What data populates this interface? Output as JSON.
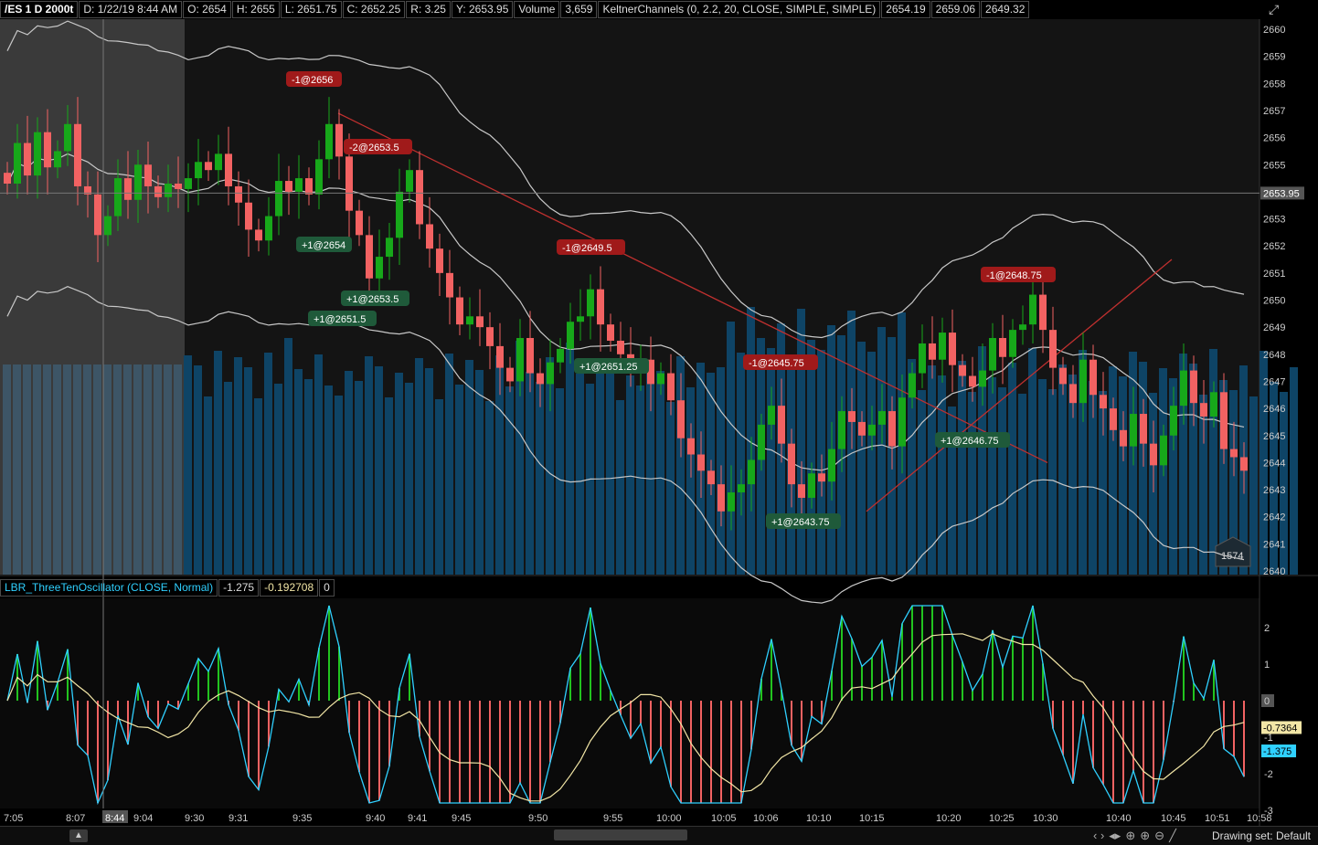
{
  "header": {
    "symbol": "/ES 1 D 2000t",
    "date": "D: 1/22/19 8:44 AM",
    "open": "O: 2654",
    "high": "H: 2655",
    "low": "L: 2651.75",
    "close": "C: 2652.25",
    "range": "R: 3.25",
    "y": "Y: 2653.95",
    "volume_label": "Volume",
    "volume_value": "3,659",
    "keltner_label": "KeltnerChannels (0, 2.2, 20, CLOSE, SIMPLE, SIMPLE)",
    "keltner_mid": "2654.19",
    "keltner_upper": "2659.06",
    "keltner_lower": "2649.32"
  },
  "oscillator_header": {
    "title": "LBR_ThreeTenOscillator (CLOSE, Normal)",
    "value1": "-1.275",
    "value2": "-0.192708",
    "value3": "0"
  },
  "bottom": {
    "drawing_set": "Drawing set: Default"
  },
  "colors": {
    "up": "#17a81a",
    "down": "#f26262",
    "volume": "#0e4466",
    "volume_shaded": "#3d5566",
    "band": "#c8c8c8",
    "trendline": "#c0302f",
    "osc_line": "#2fd0ff",
    "signal_line": "#f2e6a6",
    "buy_label": "#1f5a3a",
    "sell_label": "#a01a1a"
  },
  "chart_data": [
    {
      "type": "candlestick",
      "title": "/ES 1 D 2000t",
      "ylim": [
        2640,
        2660
      ],
      "y_ticks": [
        "2660",
        "2659",
        "2658",
        "2657",
        "2656",
        "2655",
        "2654",
        "2653",
        "2652",
        "2651",
        "2650",
        "2649",
        "2648",
        "2647",
        "2646",
        "2645",
        "2644",
        "2643",
        "2642",
        "2641",
        "2640"
      ],
      "price_line": "2653.95",
      "volume_badge": "1574",
      "x_ticks": [
        "7:05",
        "8:07",
        "9:04",
        "9:30",
        "9:31",
        "9:35",
        "9:40",
        "9:41",
        "9:45",
        "9:50",
        "9:55",
        "10:00",
        "10:05",
        "10:06",
        "10:10",
        "10:15",
        "10:20",
        "10:25",
        "10:30",
        "10:40",
        "10:45",
        "10:51",
        "10:58"
      ],
      "crosshair_time": "8:44",
      "closes": [
        2654.3,
        2655.8,
        2654.6,
        2656.2,
        2654.9,
        2655.5,
        2656.5,
        2654.2,
        2653.9,
        2652.4,
        2653.1,
        2654.5,
        2653.7,
        2655.0,
        2654.2,
        2653.8,
        2654.3,
        2654.1,
        2654.5,
        2655.1,
        2654.8,
        2655.4,
        2654.2,
        2653.6,
        2652.6,
        2652.2,
        2653.1,
        2654.4,
        2654.0,
        2654.5,
        2653.9,
        2655.2,
        2656.5,
        2655.3,
        2653.3,
        2652.4,
        2650.8,
        2651.6,
        2652.3,
        2654.0,
        2654.8,
        2652.8,
        2651.9,
        2651.0,
        2650.1,
        2649.1,
        2649.4,
        2649.0,
        2648.3,
        2647.5,
        2647.0,
        2648.6,
        2647.3,
        2646.9,
        2647.7,
        2648.2,
        2649.2,
        2649.4,
        2650.4,
        2649.1,
        2648.5,
        2648.0,
        2647.5,
        2647.8,
        2646.9,
        2647.3,
        2646.3,
        2644.9,
        2644.3,
        2643.7,
        2643.2,
        2642.2,
        2642.9,
        2643.2,
        2644.1,
        2645.4,
        2646.1,
        2644.7,
        2643.2,
        2642.7,
        2643.6,
        2643.3,
        2644.5,
        2645.9,
        2645.5,
        2645.0,
        2645.4,
        2645.9,
        2644.6,
        2646.4,
        2647.3,
        2648.4,
        2647.8,
        2648.8,
        2647.6,
        2647.2,
        2646.8,
        2647.4,
        2648.6,
        2647.9,
        2648.9,
        2649.1,
        2650.2,
        2648.9,
        2647.5,
        2646.9,
        2646.2,
        2647.8,
        2646.5,
        2646.0,
        2645.2,
        2644.6,
        2645.8,
        2644.7,
        2643.9,
        2645.0,
        2646.1,
        2647.4,
        2646.2,
        2645.7,
        2646.6,
        2644.5,
        2644.2,
        2643.7
      ]
    },
    {
      "type": "bar",
      "title": "LBR_ThreeTenOscillator (CLOSE, Normal)",
      "ylim": [
        -3,
        3
      ],
      "y_ticks": [
        "2",
        "1",
        "0",
        "-1",
        "-2",
        "-3"
      ],
      "last_signal": "-0.7364",
      "last_osc": "-1.375"
    }
  ],
  "trade_labels": [
    {
      "text": "-1@2656",
      "side": "sell"
    },
    {
      "text": "-2@2653.5",
      "side": "sell"
    },
    {
      "text": "+1@2654",
      "side": "buy"
    },
    {
      "text": "+1@2653.5",
      "side": "buy"
    },
    {
      "text": "+1@2651.5",
      "side": "buy"
    },
    {
      "text": "-1@2649.5",
      "side": "sell"
    },
    {
      "text": "+1@2651.25",
      "side": "buy"
    },
    {
      "text": "-1@2645.75",
      "side": "sell"
    },
    {
      "text": "+1@2643.75",
      "side": "buy"
    },
    {
      "text": "+1@2646.75",
      "side": "buy"
    },
    {
      "text": "-1@2648.75",
      "side": "sell"
    }
  ]
}
